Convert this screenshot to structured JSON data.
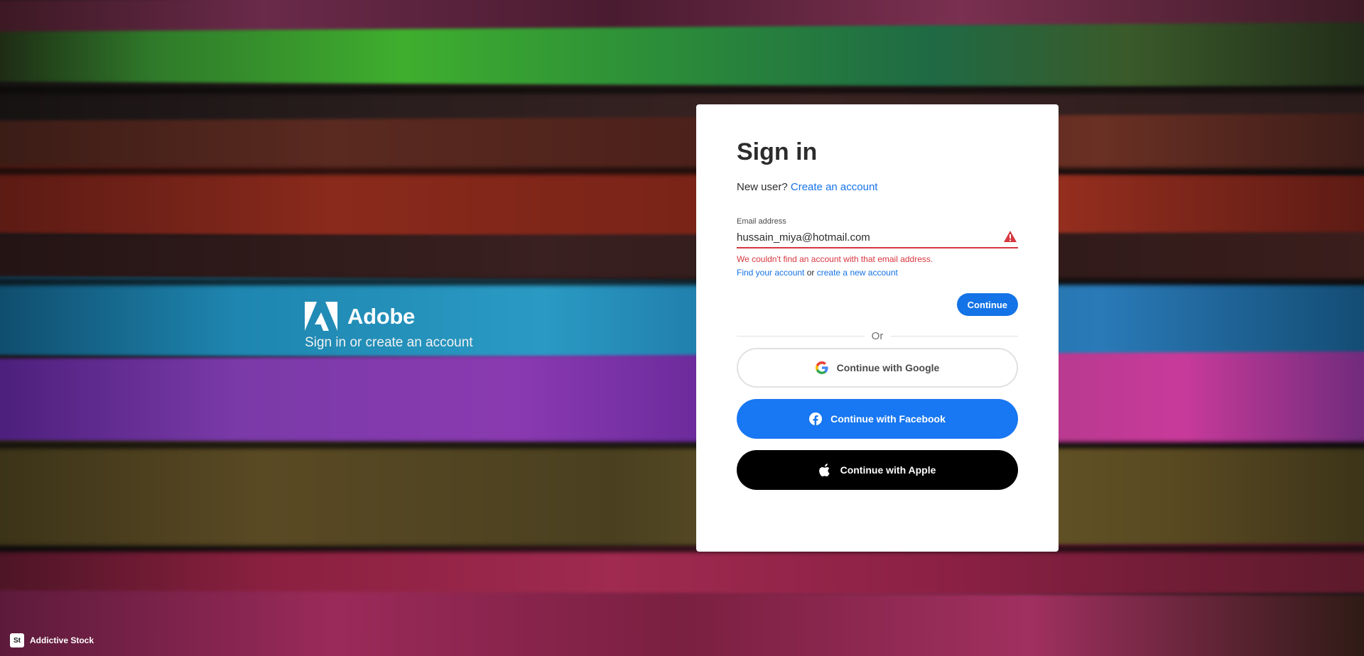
{
  "brand": {
    "name": "Adobe",
    "tagline": "Sign in or create an account"
  },
  "signin": {
    "title": "Sign in",
    "new_user_prompt": "New user?",
    "create_account_link": "Create an account",
    "email_label": "Email address",
    "email_value": "hussain_miya@hotmail.com",
    "error_message": "We couldn't find an account with that email address.",
    "find_account_link": "Find your account",
    "or_joiner": "or",
    "create_new_account_link": "create a new account",
    "continue_label": "Continue",
    "divider_label": "Or"
  },
  "social": {
    "google_label": "Continue with Google",
    "facebook_label": "Continue with Facebook",
    "apple_label": "Continue with Apple"
  },
  "footer": {
    "credit_logo": "St",
    "credit_text": "Addictive Stock"
  },
  "colors": {
    "accent": "#1473e6",
    "error": "#d7373f",
    "facebook": "#1877f2",
    "apple": "#000000"
  }
}
